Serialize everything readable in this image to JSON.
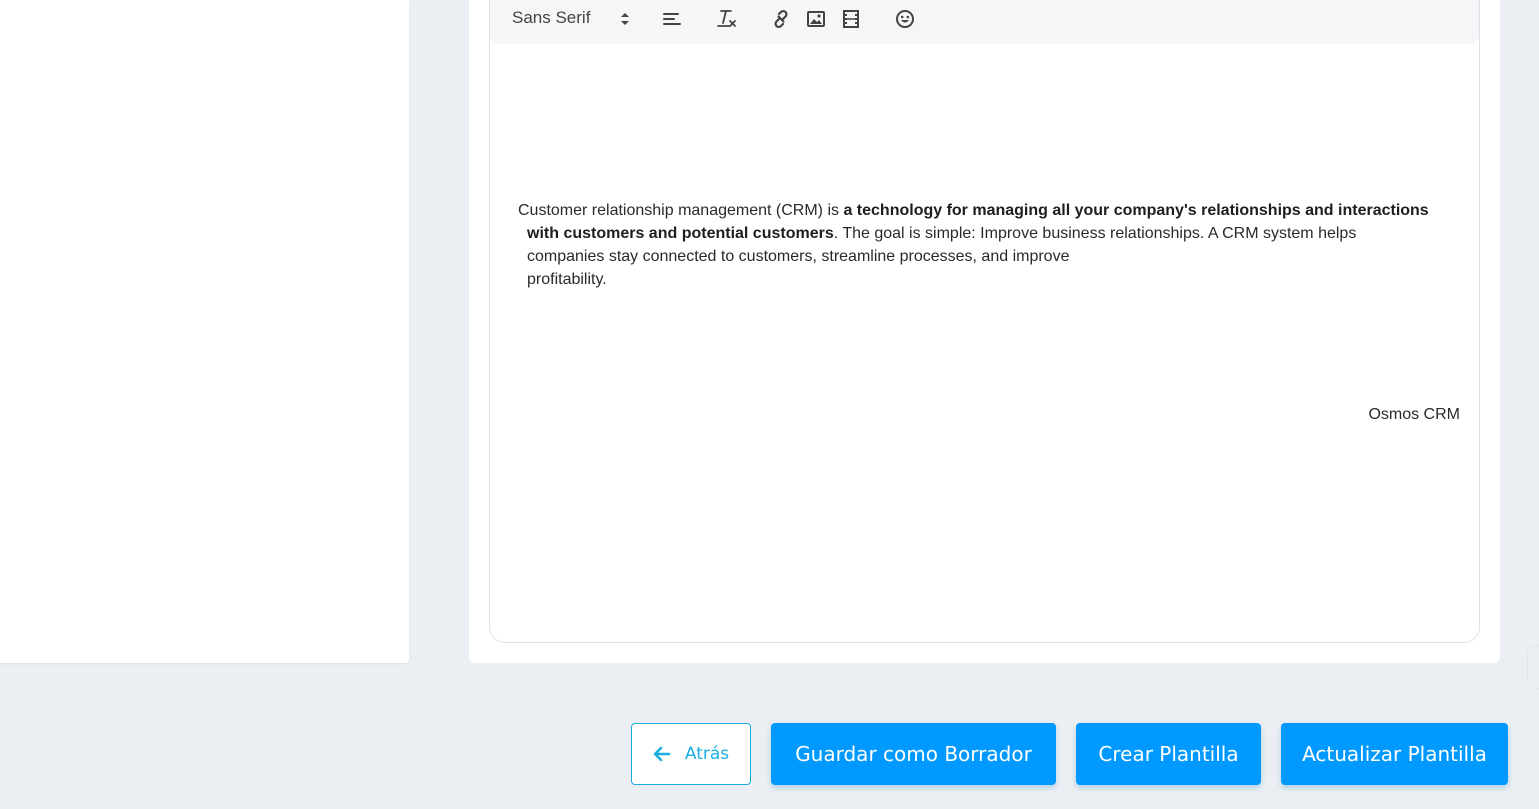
{
  "toolbar": {
    "font_select": "Sans Serif",
    "icons": [
      "align-left-icon",
      "clear-format-icon",
      "link-icon",
      "image-icon",
      "video-icon",
      "emoji-icon"
    ]
  },
  "editor": {
    "p1_plain_a": "Customer relationship management (CRM) is ",
    "p1_bold_a": "a technology for managing all your company's relationships and interactions",
    "p1_bold_b": "with customers and potential customers",
    "p1_plain_b": ". The goal is simple: Improve business relationships. A CRM system helps",
    "p1_plain_c": "companies stay connected to customers, streamline processes, and improve",
    "p1_plain_d": "profitability.",
    "signature": "Osmos CRM"
  },
  "actions": {
    "back": "Atrás",
    "save_draft": "Guardar como Borrador",
    "create": "Crear Plantilla",
    "update": "Actualizar Plantilla"
  },
  "colors": {
    "primary": "#0099ff",
    "back_accent": "#1aaee0",
    "page_bg": "#ebeff3"
  }
}
